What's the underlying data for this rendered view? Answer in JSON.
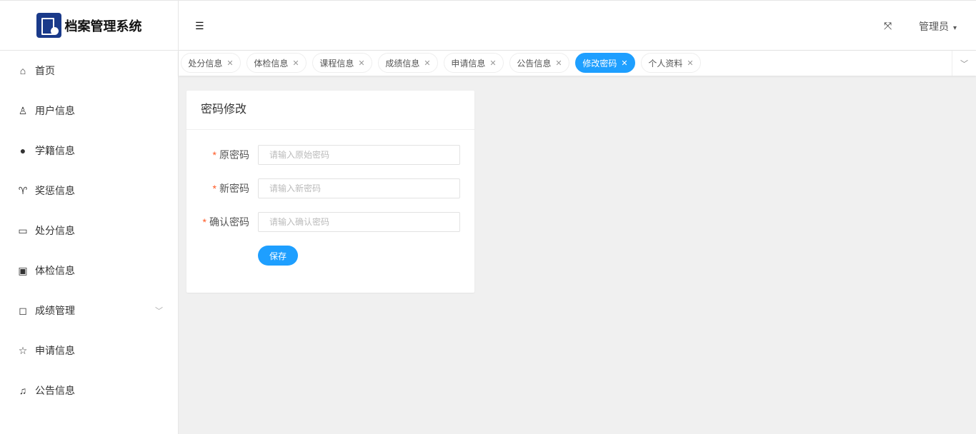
{
  "app": {
    "title": "档案管理系统"
  },
  "header": {
    "menu_icon": "☰",
    "fullscreen_icon": "⤧",
    "user": "管理员",
    "caret": "▾"
  },
  "sidebar": {
    "items": [
      {
        "label": "首页",
        "icon": "⌂"
      },
      {
        "label": "用户信息",
        "icon": "♙"
      },
      {
        "label": "学籍信息",
        "icon": "●"
      },
      {
        "label": "奖惩信息",
        "icon": "♈"
      },
      {
        "label": "处分信息",
        "icon": "▭"
      },
      {
        "label": "体检信息",
        "icon": "▣"
      },
      {
        "label": "成绩管理",
        "icon": "◻",
        "expand": "﹀"
      },
      {
        "label": "申请信息",
        "icon": "☆"
      },
      {
        "label": "公告信息",
        "icon": "♫"
      }
    ]
  },
  "tabs": [
    {
      "label": "处分信息"
    },
    {
      "label": "体检信息"
    },
    {
      "label": "课程信息"
    },
    {
      "label": "成绩信息"
    },
    {
      "label": "申请信息"
    },
    {
      "label": "公告信息"
    },
    {
      "label": "修改密码",
      "active": true
    },
    {
      "label": "个人资料"
    }
  ],
  "tab_close": "✕",
  "tab_more": "﹀",
  "form": {
    "title": "密码修改",
    "required_mark": "*",
    "fields": [
      {
        "label": "原密码",
        "placeholder": "请输入原始密码"
      },
      {
        "label": "新密码",
        "placeholder": "请输入新密码"
      },
      {
        "label": "确认密码",
        "placeholder": "请输入确认密码"
      }
    ],
    "save": "保存"
  },
  "colors": {
    "accent": "#1e9fff",
    "required": "#ff5722"
  }
}
